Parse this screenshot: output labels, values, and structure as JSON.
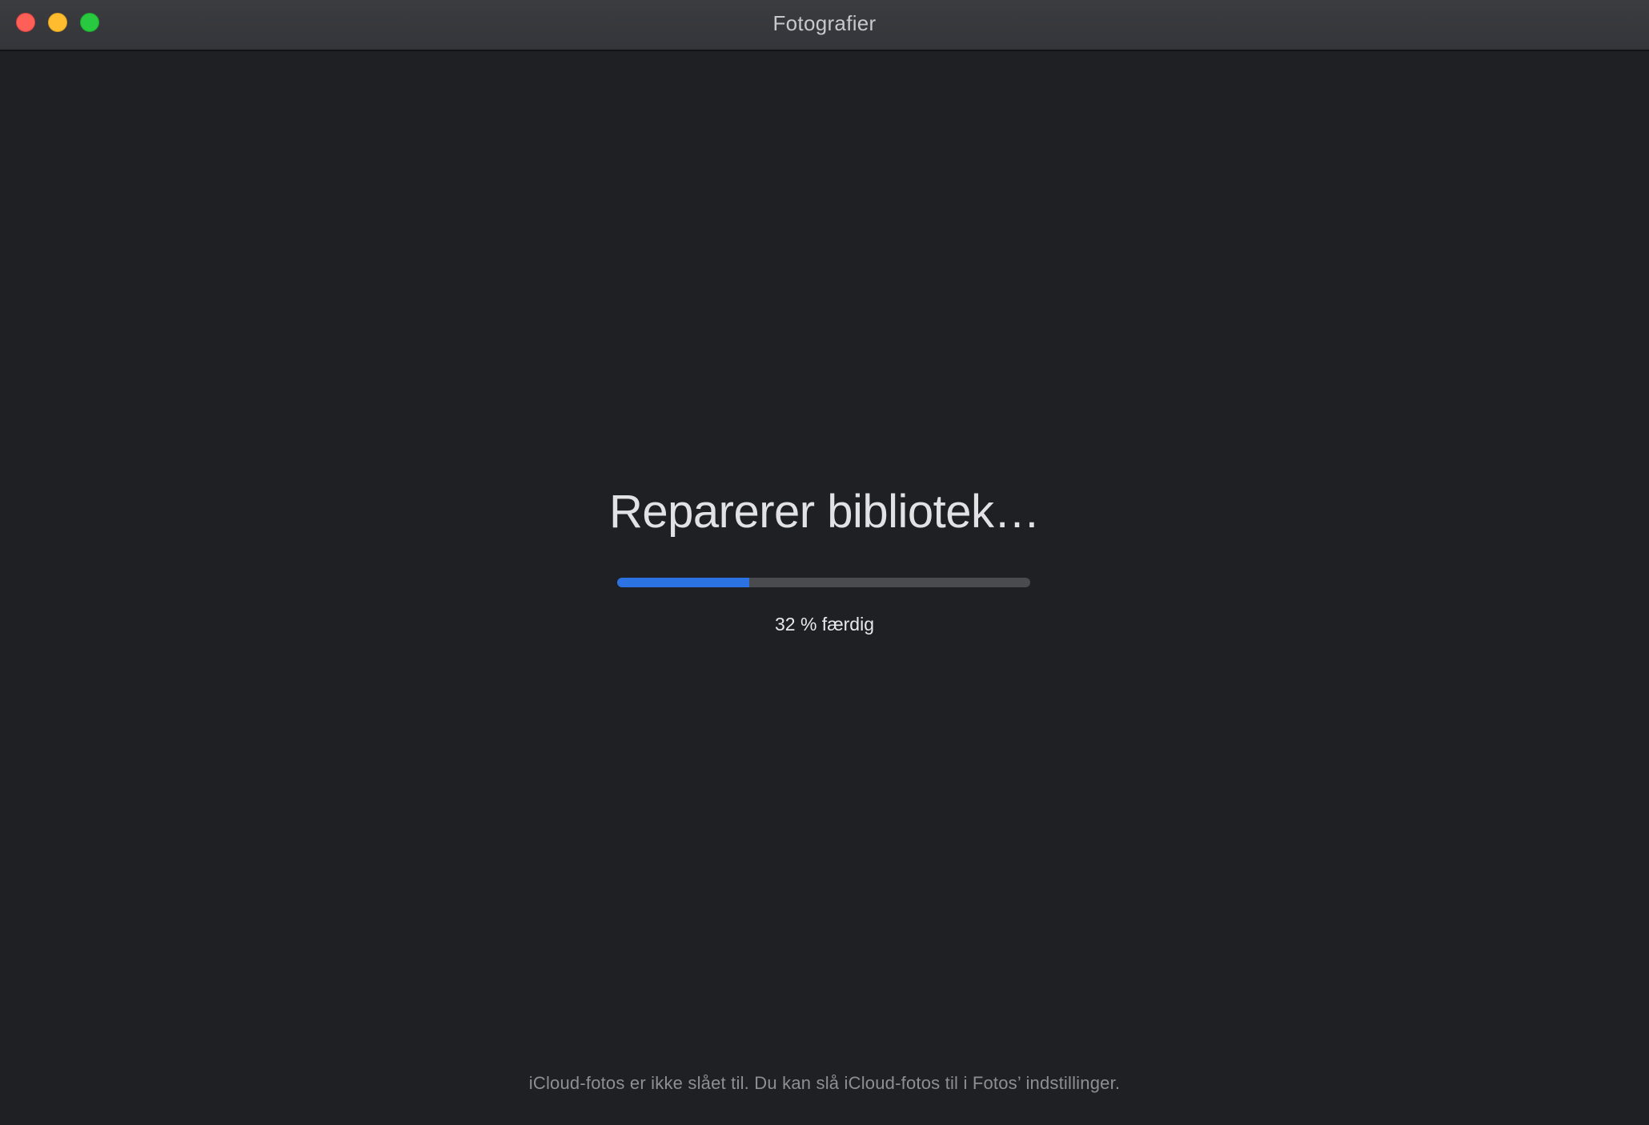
{
  "window": {
    "title": "Fotografier",
    "controls": {
      "close": "close-button",
      "minimize": "minimize-button",
      "zoom": "zoom-button"
    }
  },
  "status": {
    "heading": "Reparerer bibliotek…",
    "progress_fraction": 0.32,
    "progress_label": "32 % færdig"
  },
  "footer": {
    "note": "iCloud-fotos er ikke slået til. Du kan slå iCloud-fotos til i Fotos’ indstillinger."
  },
  "colors": {
    "accent": "#2b73e3",
    "background": "#1f2024",
    "close": "#fe5f57",
    "minimize": "#febc2e",
    "zoom": "#28c840"
  }
}
